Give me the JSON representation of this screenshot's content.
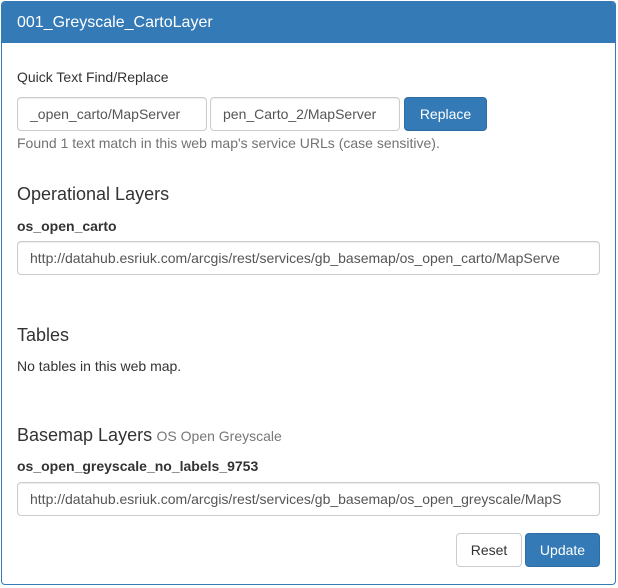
{
  "panel": {
    "title": "001_Greyscale_CartoLayer"
  },
  "find_replace": {
    "label": "Quick Text Find/Replace",
    "find_value": "_open_carto/MapServer",
    "replace_value": "pen_Carto_2/MapServer",
    "replace_button": "Replace",
    "help_text": "Found 1 text match in this web map's service URLs (case sensitive)."
  },
  "operational_layers": {
    "heading": "Operational Layers",
    "layer_name": "os_open_carto",
    "layer_url": "http://datahub.esriuk.com/arcgis/rest/services/gb_basemap/os_open_carto/MapServe"
  },
  "tables": {
    "heading": "Tables",
    "message": "No tables in this web map."
  },
  "basemap_layers": {
    "heading": "Basemap Layers",
    "subtitle": "OS Open Greyscale",
    "layer_name": "os_open_greyscale_no_labels_9753",
    "layer_url": "http://datahub.esriuk.com/arcgis/rest/services/gb_basemap/os_open_greyscale/MapS"
  },
  "footer": {
    "reset_button": "Reset",
    "update_button": "Update"
  }
}
